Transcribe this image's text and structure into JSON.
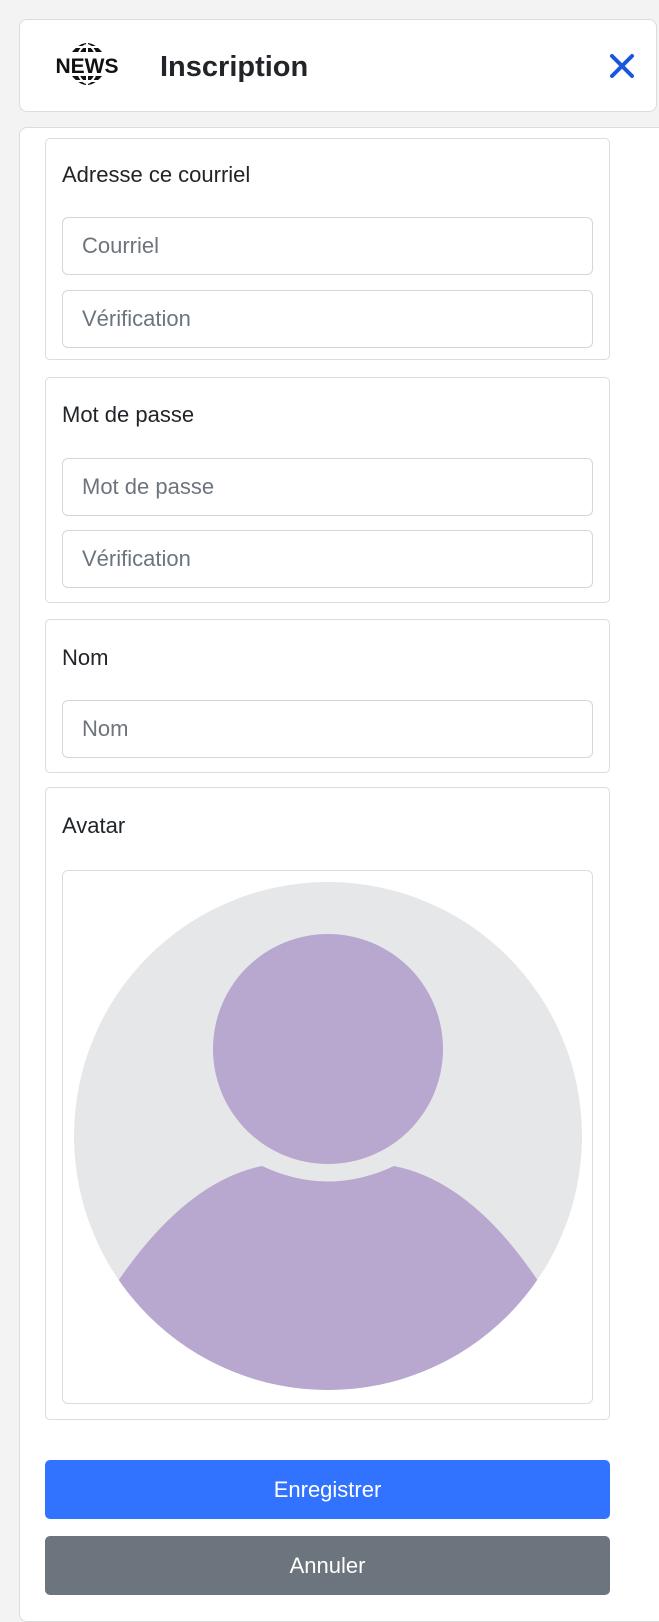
{
  "header": {
    "logo_text": "NEWS",
    "title": "Inscription",
    "close_icon": "close-icon"
  },
  "email_group": {
    "label": "Adresse ce courriel",
    "email_placeholder": "Courriel",
    "verify_placeholder": "Vérification"
  },
  "password_group": {
    "label": "Mot de passe",
    "password_placeholder": "Mot de passe",
    "verify_placeholder": "Vérification"
  },
  "name_group": {
    "label": "Nom",
    "name_placeholder": "Nom"
  },
  "avatar_group": {
    "label": "Avatar",
    "icon": "default-avatar-icon"
  },
  "actions": {
    "save_label": "Enregistrer",
    "cancel_label": "Annuler"
  },
  "colors": {
    "primary": "#3173ff",
    "secondary": "#6c757d",
    "close": "#1a56db",
    "avatar_bg": "#e6e7e9",
    "avatar_fg": "#b8a7cf"
  }
}
